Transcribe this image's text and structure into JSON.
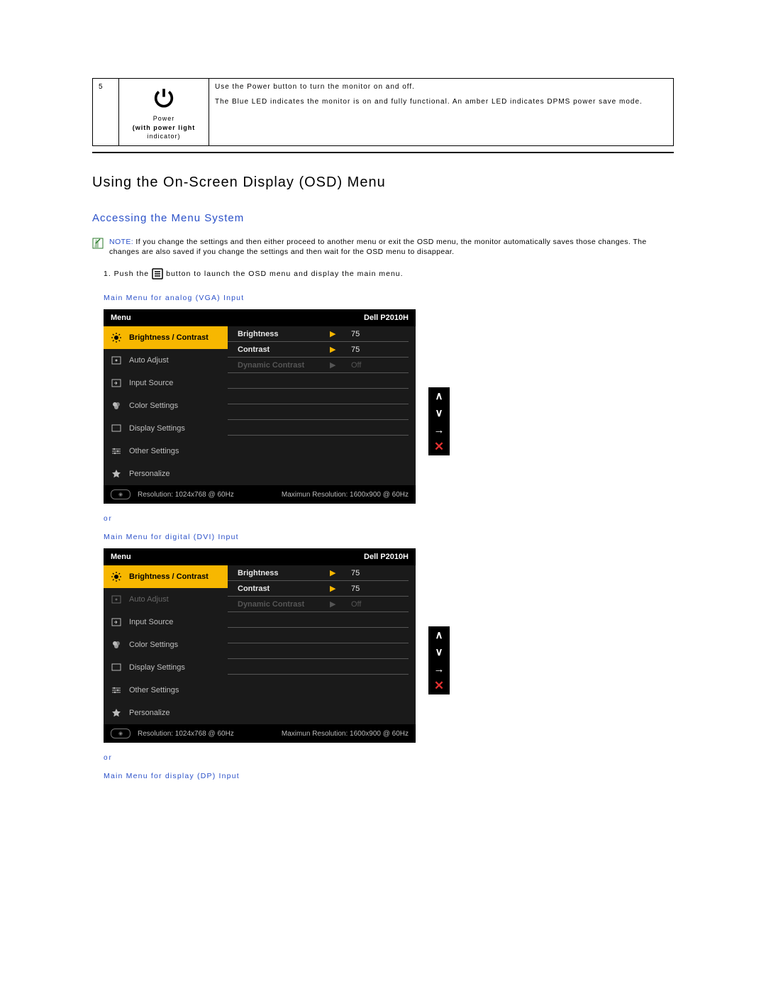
{
  "table": {
    "num": "5",
    "label1": "Power",
    "label2": "(with power light",
    "label3": "indicator)",
    "desc1": "Use the Power button to turn the monitor on and off.",
    "desc2": "The Blue LED indicates the monitor is on and fully functional. An amber LED indicates DPMS power save mode."
  },
  "headings": {
    "osd": "Using the On-Screen Display (OSD) Menu",
    "access": "Accessing the Menu System"
  },
  "note": {
    "label": "NOTE:",
    "text": " If you change the settings and then either proceed to another menu or exit the OSD menu, the monitor automatically saves those changes. The changes are also saved if you change the settings and then wait for the OSD menu to disappear."
  },
  "step1": {
    "prefix": "1. Push the ",
    "suffix": " button to launch the OSD menu and display the main menu."
  },
  "captions": {
    "vga": "Main Menu for analog (VGA) Input",
    "dvi": "Main Menu for digital (DVI) Input",
    "dp": "Main Menu for display (DP) Input",
    "or": "or"
  },
  "osd_common": {
    "menu": "Menu",
    "model": "Dell  P2010H",
    "side": [
      "Brightness / Contrast",
      "Auto Adjust",
      "Input Source",
      "Color Settings",
      "Display Settings",
      "Other Settings",
      "Personalize"
    ],
    "rows": {
      "brightness": "Brightness",
      "contrast": "Contrast",
      "dynamic": "Dynamic Contrast",
      "val75": "75",
      "off": "Off"
    },
    "footer": {
      "res": "Resolution: 1024x768 @ 60Hz",
      "max": "Maximun Resolution: 1600x900 @ 60Hz"
    }
  },
  "buttons": {
    "up": "∧",
    "down": "∨",
    "right": "→",
    "close": "✕"
  }
}
